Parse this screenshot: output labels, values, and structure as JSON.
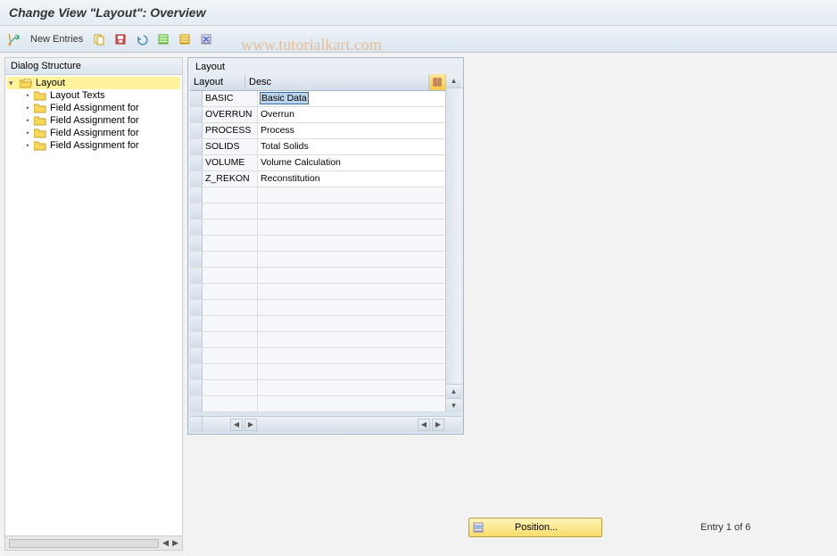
{
  "title": "Change View \"Layout\": Overview",
  "watermark": "www.tutorialkart.com",
  "toolbar": {
    "new_entries": "New Entries"
  },
  "left_pane": {
    "header": "Dialog Structure",
    "root": "Layout",
    "children": [
      "Layout Texts",
      "Field Assignment for",
      "Field Assignment for",
      "Field Assignment for",
      "Field Assignment for"
    ]
  },
  "panel": {
    "title": "Layout",
    "columns": {
      "layout": "Layout",
      "desc": "Desc"
    },
    "rows": [
      {
        "layout": "BASIC",
        "desc": "Basic Data",
        "selected": true
      },
      {
        "layout": "OVERRUN",
        "desc": "Overrun"
      },
      {
        "layout": "PROCESS",
        "desc": "Process"
      },
      {
        "layout": "SOLIDS",
        "desc": "Total Solids"
      },
      {
        "layout": "VOLUME",
        "desc": "Volume Calculation"
      },
      {
        "layout": "Z_REKON",
        "desc": "Reconstitution"
      }
    ]
  },
  "footer": {
    "position": "Position...",
    "entry_count": "Entry 1 of 6"
  }
}
